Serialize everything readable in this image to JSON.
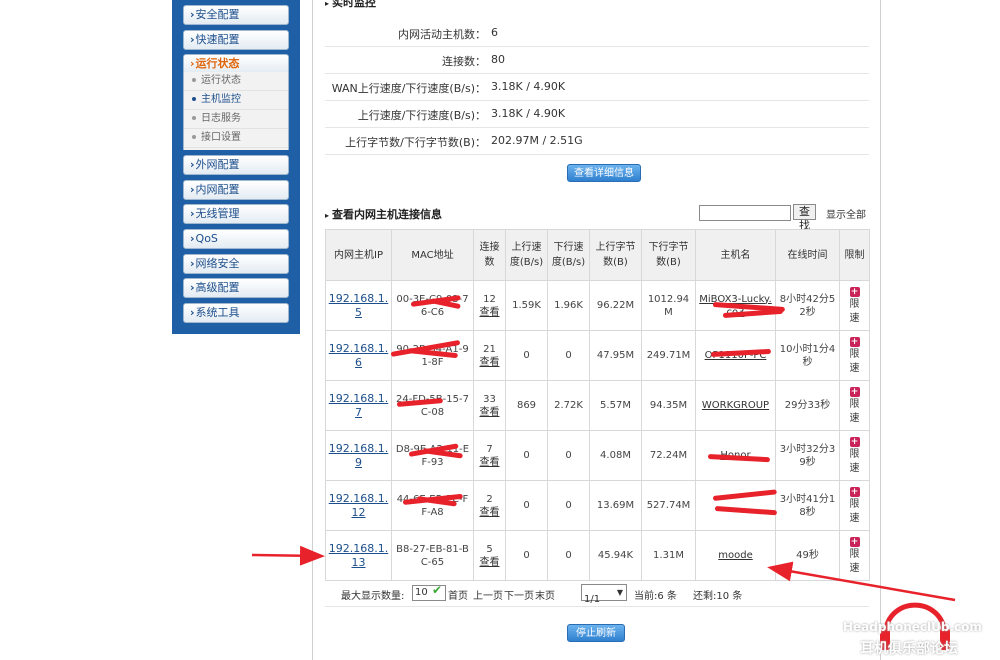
{
  "sidebar": {
    "items": [
      {
        "label": "安全配置",
        "active": false
      },
      {
        "label": "快速配置",
        "active": false
      },
      {
        "label": "运行状态",
        "active": true
      },
      {
        "label": "外网配置",
        "active": false
      },
      {
        "label": "内网配置",
        "active": false
      },
      {
        "label": "无线管理",
        "active": false
      },
      {
        "label": "QoS",
        "active": false
      },
      {
        "label": "网络安全",
        "active": false
      },
      {
        "label": "高级配置",
        "active": false
      },
      {
        "label": "系统工具",
        "active": false
      }
    ],
    "sub_items": [
      {
        "label": "运行状态",
        "current": false
      },
      {
        "label": "主机监控",
        "current": true
      },
      {
        "label": "日志服务",
        "current": false
      },
      {
        "label": "接口设置",
        "current": false
      }
    ]
  },
  "realtime": {
    "title": "实时监控",
    "stats": [
      {
        "label": "内网活动主机数：",
        "value": "6"
      },
      {
        "label": "连接数：",
        "value": "80"
      },
      {
        "label": "WAN上行速度/下行速度(B/s)：",
        "value": "3.18K  /  4.90K"
      },
      {
        "label": "上行速度/下行速度(B/s)：",
        "value": "3.18K  /  4.90K"
      },
      {
        "label": "上行字节数/下行字节数(B)：",
        "value": "202.97M  /  2.51G"
      }
    ],
    "detail_button": "查看详细信息"
  },
  "connections": {
    "title": "查看内网主机连接信息",
    "search_placeholder": "",
    "search_button": "查找",
    "show_all": "显示全部",
    "headers": [
      "内网主机IP",
      "MAC地址",
      "连接数",
      "上行速度(B/s)",
      "下行速度(B/s)",
      "上行字节数(B)",
      "下行字节数(B)",
      "主机名",
      "在线时间",
      "限制"
    ],
    "view_label": "查看",
    "limit_label": "限速",
    "rows": [
      {
        "ip": "192.168.1.5",
        "mac": "00-3E-C9-03-76-C6",
        "conns": "12",
        "up_speed": "1.59K",
        "down_speed": "1.96K",
        "up_bytes": "96.22M",
        "down_bytes": "1012.94M",
        "host": "MiBOX3-Lucky.co3",
        "online": "8小时42分52秒"
      },
      {
        "ip": "192.168.1.6",
        "mac": "90-2B-34-A1-91-8F",
        "conns": "21",
        "up_speed": "0",
        "down_speed": "0",
        "up_bytes": "47.95M",
        "down_bytes": "249.71M",
        "host": "OP1110P-PC",
        "online": "10小时1分4秒"
      },
      {
        "ip": "192.168.1.7",
        "mac": "24-FD-5B-15-7C-08",
        "conns": "33",
        "up_speed": "869",
        "down_speed": "2.72K",
        "up_bytes": "5.57M",
        "down_bytes": "94.35M",
        "host": "WORKGROUP",
        "online": "29分33秒"
      },
      {
        "ip": "192.168.1.9",
        "mac": "D8-9E-A2-11-EF-93",
        "conns": "7",
        "up_speed": "0",
        "down_speed": "0",
        "up_bytes": "4.08M",
        "down_bytes": "72.24M",
        "host": "Honor",
        "online": "3小时32分39秒"
      },
      {
        "ip": "192.168.1.12",
        "mac": "44-6E-E5-2C-FF-A8",
        "conns": "2",
        "up_speed": "0",
        "down_speed": "0",
        "up_bytes": "13.69M",
        "down_bytes": "527.74M",
        "host": "",
        "online": "3小时41分18秒"
      },
      {
        "ip": "192.168.1.13",
        "mac": "B8-27-EB-81-BC-65",
        "conns": "5",
        "up_speed": "0",
        "down_speed": "0",
        "up_bytes": "45.94K",
        "down_bytes": "1.31M",
        "host": "moode",
        "online": "49秒"
      }
    ]
  },
  "pager": {
    "max_label": "最大显示数量:",
    "max_value": "10",
    "first": "首页",
    "prev": "上一页",
    "next": "下一页",
    "last": "末页",
    "page_value": "1/1",
    "current_label": "当前:6 条",
    "total_label": "还剩:10 条"
  },
  "stop_button": "停止刷新",
  "watermark": {
    "line1": "HeadphoneclUb.com",
    "line2": "耳机俱乐部论坛"
  },
  "colors": {
    "sidebar_bg": "#1f5fa6",
    "active_nav": "#e0650a",
    "button_blue": "#2f80cf",
    "redaction": "#e8222a",
    "arrow": "#e8222a"
  }
}
